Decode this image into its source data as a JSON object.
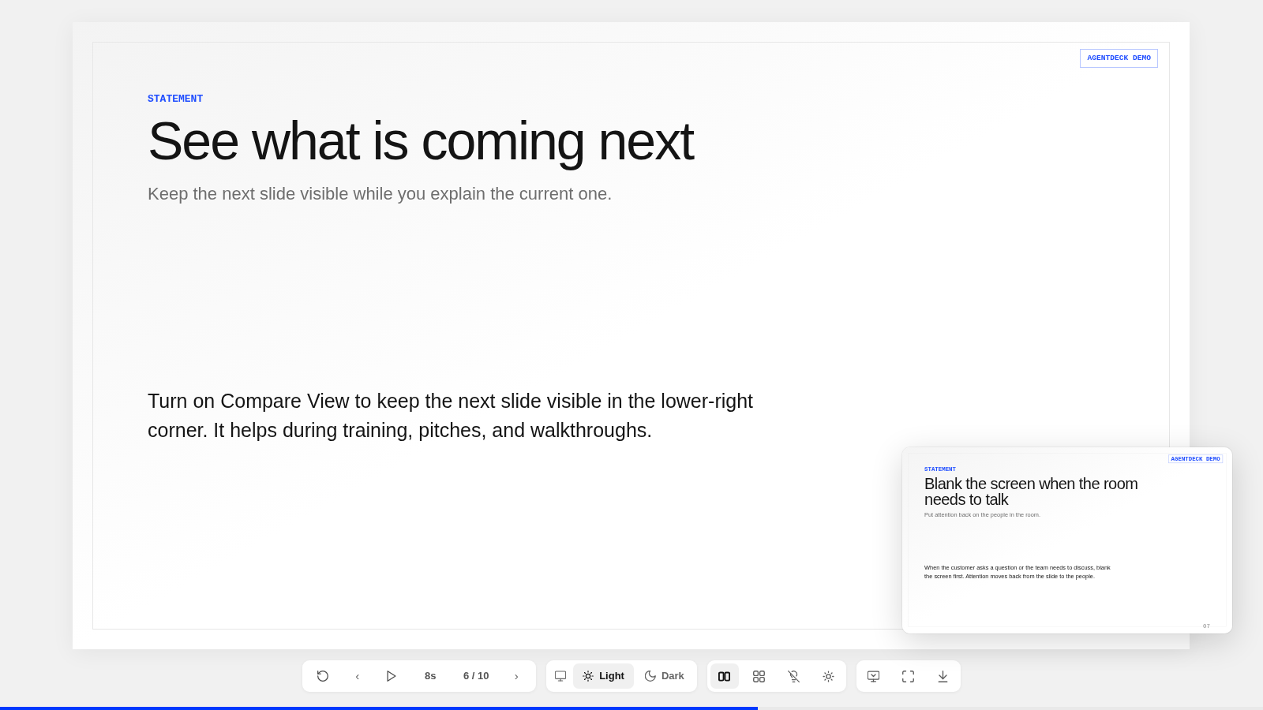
{
  "current_slide": {
    "badge": "AGENTDECK DEMO",
    "eyebrow": "STATEMENT",
    "title": "See what is coming next",
    "subtitle": "Keep the next slide visible while you explain the current one.",
    "body": "Turn on Compare View to keep the next slide visible in the lower-right corner. It helps during training, pitches, and walkthroughs."
  },
  "next_slide_preview": {
    "badge": "AGENTDECK DEMO",
    "eyebrow": "STATEMENT",
    "title": "Blank the screen when the room needs to talk",
    "subtitle": "Put attention back on the people in the room.",
    "body": "When the customer asks a question or the team needs to discuss, blank the screen first. Attention moves back from the slide to the people.",
    "page_number": "07"
  },
  "toolbar": {
    "playback": {
      "previous": "‹",
      "interval": "8s",
      "position": "6 / 10",
      "next": "›"
    },
    "theme_options": [
      {
        "selected": false
      },
      {
        "label": "Light",
        "selected": true
      },
      {
        "label": "Dark",
        "selected": false
      }
    ],
    "view_tools": [
      {
        "selected": true
      },
      {
        "selected": false
      },
      {
        "selected": false
      },
      {
        "selected": false
      }
    ]
  },
  "progress": {
    "level": 0.6
  }
}
